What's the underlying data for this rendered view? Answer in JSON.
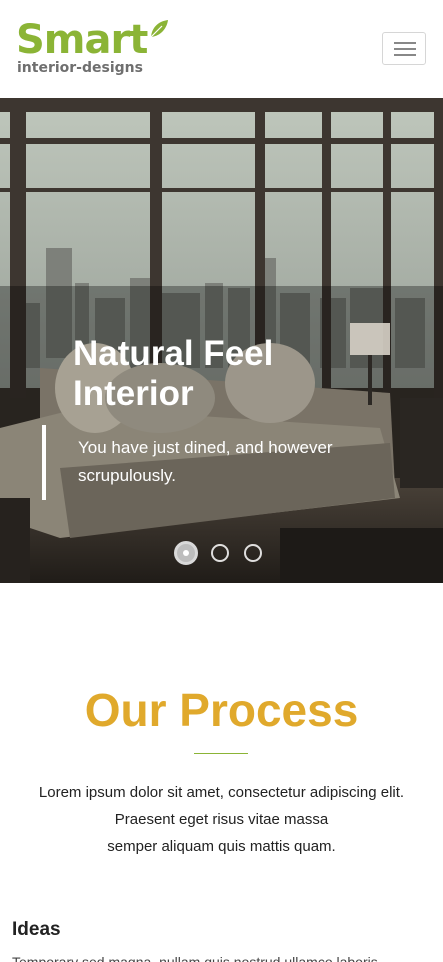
{
  "logo": {
    "word": "Smart",
    "subtitle": "interior-designs",
    "brand_green": "#8bb436"
  },
  "header": {
    "menu_icon": "hamburger-menu-icon"
  },
  "hero": {
    "title": "Natural Feel Interior",
    "text": "You have just dined, and however scrupulously.",
    "slides_count": 3,
    "active_slide": 1
  },
  "process": {
    "title": "Our Process",
    "title_color": "#e0a92c",
    "lines": [
      "Lorem ipsum dolor sit amet, consectetur adipiscing elit.",
      "Praesent eget risus vitae massa",
      "semper aliquam quis mattis quam."
    ]
  },
  "ideas": {
    "heading": "Ideas",
    "text": "Temporary sed magna, nullam quis nostrud ullamco laboris exercitation"
  }
}
